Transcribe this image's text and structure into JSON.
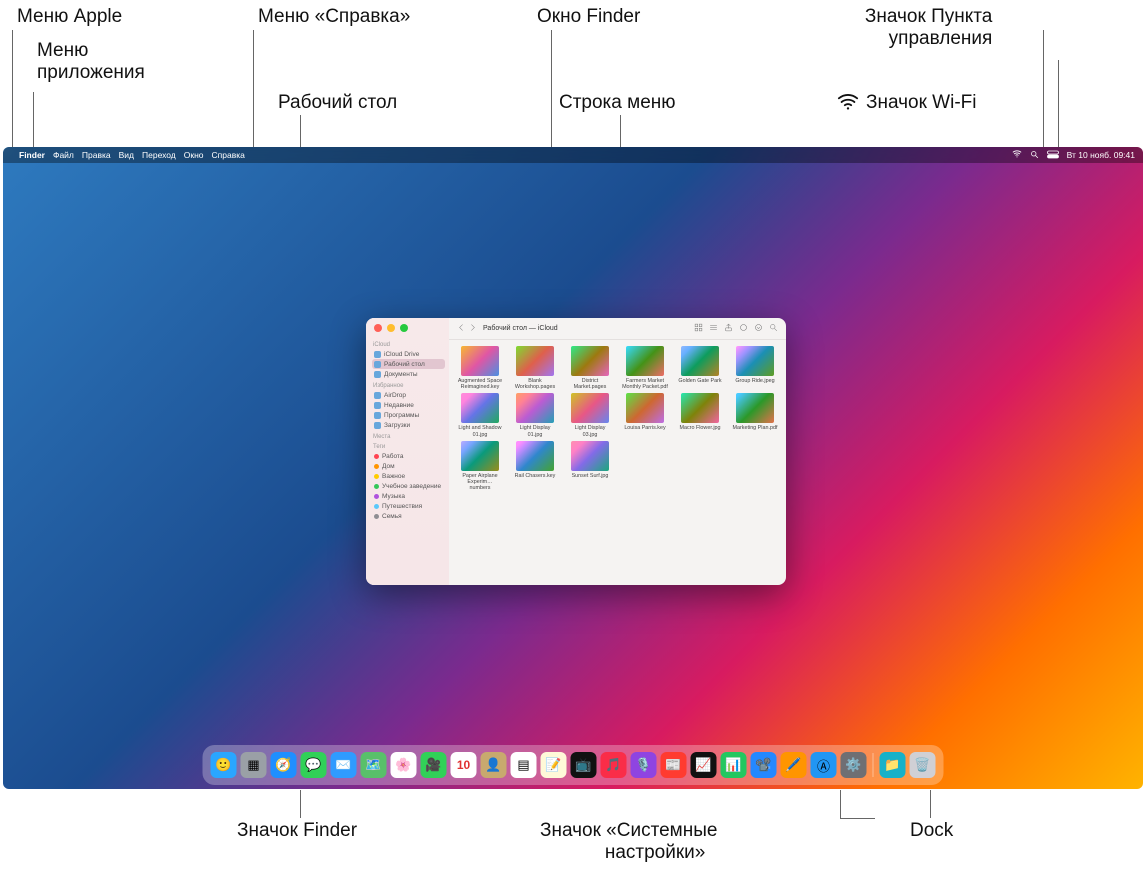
{
  "callouts": {
    "apple_menu": "Меню Apple",
    "app_menu": "Меню\nприложения",
    "help_menu": "Меню «Справка»",
    "desktop": "Рабочий стол",
    "finder_window": "Окно Finder",
    "menubar": "Строка меню",
    "wifi_icon": "Значок Wi-Fi",
    "control_center_icon": "Значок Пункта\n      управления",
    "finder_icon": "Значок Finder",
    "sysprefs_icon": "Значок «Системные\n          настройки»",
    "dock": "Dock"
  },
  "menubar": {
    "app": "Finder",
    "items": [
      "Файл",
      "Правка",
      "Вид",
      "Переход",
      "Окно",
      "Справка"
    ],
    "clock": "Вт 10 нояб.   09:41"
  },
  "finder": {
    "title": "Рабочий стол — iCloud",
    "sidebar": {
      "sections": [
        {
          "label": "iCloud",
          "items": [
            {
              "name": "icloud-drive-row",
              "icon": "cloud",
              "label": "iCloud Drive",
              "sel": false
            },
            {
              "name": "desktop-row",
              "icon": "desktop",
              "label": "Рабочий стол",
              "sel": true
            },
            {
              "name": "documents-row",
              "icon": "doc",
              "label": "Документы",
              "sel": false
            }
          ]
        },
        {
          "label": "Избранное",
          "items": [
            {
              "name": "airdrop-row",
              "icon": "airdrop",
              "label": "AirDrop"
            },
            {
              "name": "recents-row",
              "icon": "clock",
              "label": "Недавние"
            },
            {
              "name": "apps-row",
              "icon": "app",
              "label": "Программы"
            },
            {
              "name": "downloads-row",
              "icon": "down",
              "label": "Загрузки"
            }
          ]
        },
        {
          "label": "Места",
          "items": []
        },
        {
          "label": "Теги",
          "items": [
            {
              "name": "tag-work",
              "dot": "#ff4351",
              "label": "Работа"
            },
            {
              "name": "tag-home",
              "dot": "#ff9500",
              "label": "Дом"
            },
            {
              "name": "tag-important",
              "dot": "#ffcc00",
              "label": "Важное"
            },
            {
              "name": "tag-school",
              "dot": "#34c759",
              "label": "Учебное заведение"
            },
            {
              "name": "tag-music",
              "dot": "#af52de",
              "label": "Музыка"
            },
            {
              "name": "tag-travel",
              "dot": "#5ac8fa",
              "label": "Путешествия"
            },
            {
              "name": "tag-family",
              "dot": "#8e8e93",
              "label": "Семья"
            }
          ]
        }
      ]
    },
    "files": [
      "Augmented Space Reimagined.key",
      "Blank Workshop.pages",
      "District Market.pages",
      "Farmers Market Monthly Packet.pdf",
      "Golden Gate Park",
      "Group Ride.jpeg",
      "Light and Shadow 01.jpg",
      "Light Display 01.jpg",
      "Light Display 03.jpg",
      "Louisa Parris.key",
      "Macro Flower.jpg",
      "Marketing Plan.pdf",
      "Paper Airplane Experim…numbers",
      "Rail Chasers.key",
      "Sunset Surf.jpg"
    ]
  },
  "dock": {
    "apps": [
      {
        "name": "finder",
        "bg": "#2aa6ff",
        "glyph": "🙂"
      },
      {
        "name": "launchpad",
        "bg": "#9aa0a6",
        "glyph": "▦"
      },
      {
        "name": "safari",
        "bg": "#1f8fff",
        "glyph": "🧭"
      },
      {
        "name": "messages",
        "bg": "#31d158",
        "glyph": "💬"
      },
      {
        "name": "mail",
        "bg": "#2f9bff",
        "glyph": "✉️"
      },
      {
        "name": "maps",
        "bg": "#59c06a",
        "glyph": "🗺️"
      },
      {
        "name": "photos",
        "bg": "#ffffff",
        "glyph": "🌸"
      },
      {
        "name": "facetime",
        "bg": "#31d158",
        "glyph": "🎥"
      },
      {
        "name": "calendar",
        "bg": "#ffffff",
        "glyph": "10"
      },
      {
        "name": "contacts",
        "bg": "#c8a96e",
        "glyph": "👤"
      },
      {
        "name": "reminders",
        "bg": "#ffffff",
        "glyph": "▤"
      },
      {
        "name": "notes",
        "bg": "#fff9d8",
        "glyph": "📝"
      },
      {
        "name": "tv",
        "bg": "#111111",
        "glyph": "📺"
      },
      {
        "name": "music",
        "bg": "#fa2d48",
        "glyph": "🎵"
      },
      {
        "name": "podcasts",
        "bg": "#8f44e1",
        "glyph": "🎙️"
      },
      {
        "name": "news",
        "bg": "#ff3b30",
        "glyph": "📰"
      },
      {
        "name": "stocks",
        "bg": "#111111",
        "glyph": "📈"
      },
      {
        "name": "numbers",
        "bg": "#24c760",
        "glyph": "📊"
      },
      {
        "name": "keynote",
        "bg": "#2488ff",
        "glyph": "📽️"
      },
      {
        "name": "pages",
        "bg": "#ff9500",
        "glyph": "🖊️"
      },
      {
        "name": "appstore",
        "bg": "#2196f3",
        "glyph": "Ⓐ"
      },
      {
        "name": "system-preferences",
        "bg": "#6f6f73",
        "glyph": "⚙️"
      }
    ],
    "right": [
      {
        "name": "downloads",
        "bg": "#17b1c8",
        "glyph": "📁"
      },
      {
        "name": "trash",
        "bg": "#d0d0d5",
        "glyph": "🗑️"
      }
    ]
  }
}
